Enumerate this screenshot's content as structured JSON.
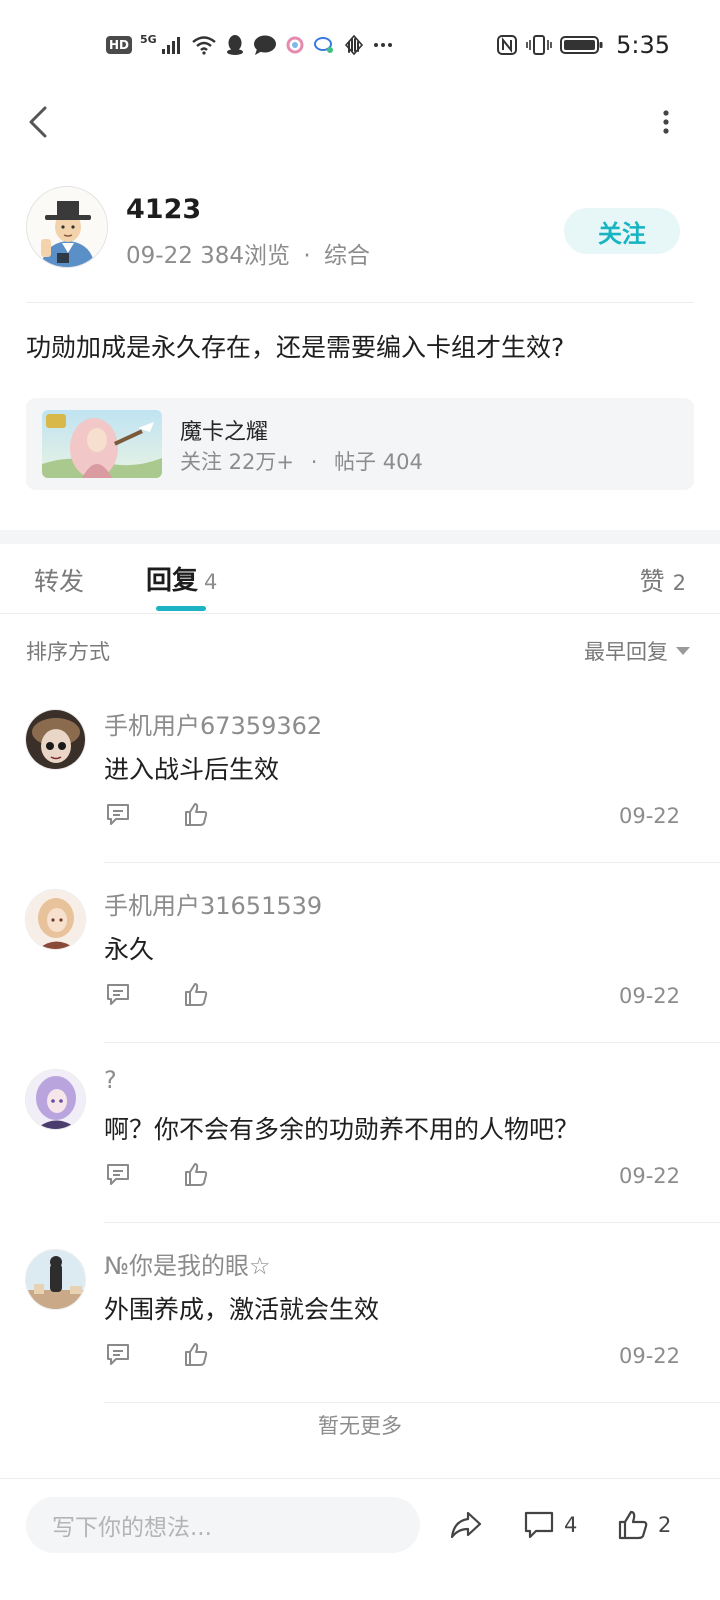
{
  "status_bar": {
    "hd": "HD",
    "net": "5G",
    "time": "5:35"
  },
  "post": {
    "author_name": "4123",
    "date": "09-22",
    "views": "384浏览",
    "category": "综合",
    "meta_sep": "·",
    "follow_label": "关注",
    "title": "功勋加成是永久存在，还是需要编入卡组才生效?"
  },
  "community": {
    "name": "魔卡之耀",
    "followers": "关注 22万+",
    "sep": "·",
    "posts": "帖子 404"
  },
  "tabs": {
    "repost": "转发",
    "reply": "回复",
    "reply_count": "4",
    "like": "赞",
    "like_count": "2"
  },
  "sort": {
    "label": "排序方式",
    "value": "最早回复"
  },
  "replies": [
    {
      "user": "手机用户67359362",
      "text": "进入战斗后生效",
      "date": "09-22"
    },
    {
      "user": "手机用户31651539",
      "text": "永久",
      "date": "09-22"
    },
    {
      "user": "?",
      "text": "啊？你不会有多余的功勋养不用的人物吧？",
      "date": "09-22"
    },
    {
      "user": "№你是我的眼☆",
      "text": "外围养成，激活就会生效",
      "date": "09-22"
    }
  ],
  "no_more": "暂无更多",
  "bottom_bar": {
    "input_placeholder": "写下你的想法...",
    "comment_count": "4",
    "like_count": "2"
  },
  "colors": {
    "accent": "#1cb3c4",
    "follow_bg": "#e7f7f8",
    "muted_text": "#8c8c8c",
    "card_bg": "#f4f5f7"
  }
}
